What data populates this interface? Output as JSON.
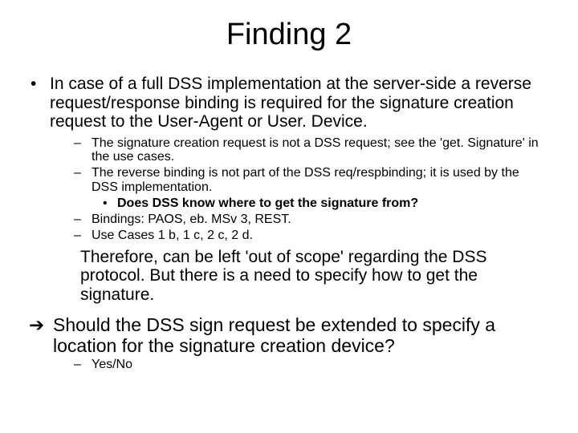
{
  "title": "Finding 2",
  "l1": {
    "text": "In case of a full DSS implementation at the server-side a reverse request/response binding is required for the signature creation request to the User-Agent or User. Device."
  },
  "l2": [
    "The signature creation request is not a DSS request; see the 'get. Signature' in the use cases.",
    "The reverse binding is not part of the DSS req/respbinding; it is used by the DSS implementation.",
    "Bindings: PAOS, eb. MSv 3, REST.",
    "Use Cases 1 b, 1 c, 2 c, 2 d."
  ],
  "l3": "Does DSS know where to get the signature from?",
  "therefore": "Therefore, can be left 'out of scope' regarding the DSS protocol. But there is a need to specify how to get the signature.",
  "arrow": "Should the DSS sign request be extended to specify a location for the signature creation device?",
  "yesno": "Yes/No",
  "marks": {
    "dot": "•",
    "dash": "–",
    "arrow": "➔"
  }
}
